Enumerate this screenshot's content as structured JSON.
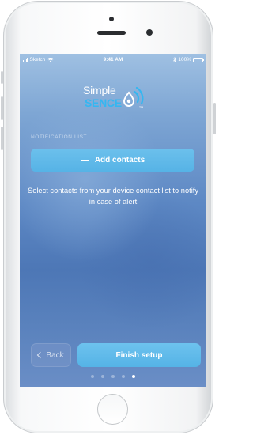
{
  "status_bar": {
    "carrier": "Sketch",
    "time": "9:41 AM",
    "battery": "100%"
  },
  "logo": {
    "word1": "Simple",
    "word2": "SENCE",
    "trademark": "TM"
  },
  "section": {
    "label": "NOTIFICATION LIST"
  },
  "add_contacts": {
    "label": "Add contacts"
  },
  "help": {
    "text": "Select contacts from your device contact list to notify in case of alert"
  },
  "buttons": {
    "back": "Back",
    "finish": "Finish setup"
  },
  "pagination": {
    "total": 5,
    "current": 5
  },
  "colors": {
    "accent": "#56b3e6",
    "logo_blue": "#34b7f1"
  }
}
